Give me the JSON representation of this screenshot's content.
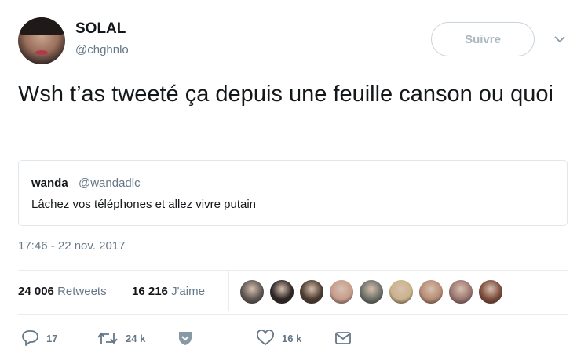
{
  "author": {
    "display_name": "SOLAL",
    "handle": "@chghnlo",
    "avatar_icon": "user-avatar"
  },
  "follow_label": "Suivre",
  "tweet": {
    "text": "Wsh t’as tweeté ça depuis une feuille canson ou quoi"
  },
  "quoted_tweet": {
    "name": "wanda",
    "handle": "@wandadlc",
    "text": "Lâchez vos téléphones et allez vivre putain"
  },
  "timestamp": "17:46 - 22 nov. 2017",
  "stats": {
    "retweets_count": "24 006",
    "retweets_label": "Retweets",
    "likes_count": "16 216",
    "likes_label": "J'aime"
  },
  "likers": [
    {
      "icon": "liker-avatar",
      "color": "#5c5550"
    },
    {
      "icon": "liker-avatar",
      "color": "#2a2524"
    },
    {
      "icon": "liker-avatar",
      "color": "#4a3a2e"
    },
    {
      "icon": "liker-avatar",
      "color": "#c69b8a"
    },
    {
      "icon": "liker-avatar",
      "color": "#6a6e66"
    },
    {
      "icon": "liker-avatar",
      "color": "#c9b28a"
    },
    {
      "icon": "liker-avatar",
      "color": "#b58c74"
    },
    {
      "icon": "liker-avatar",
      "color": "#9a7570"
    },
    {
      "icon": "liker-avatar",
      "color": "#7a4a3a"
    }
  ],
  "actions": {
    "reply_count": "17",
    "retweet_count": "24 k",
    "like_count": "16 k",
    "icons": [
      "reply-icon",
      "retweet-icon",
      "shield-icon",
      "heart-icon",
      "envelope-icon"
    ]
  },
  "colors": {
    "text": "#14171a",
    "secondary": "#657786",
    "border": "#e1e8ed"
  }
}
